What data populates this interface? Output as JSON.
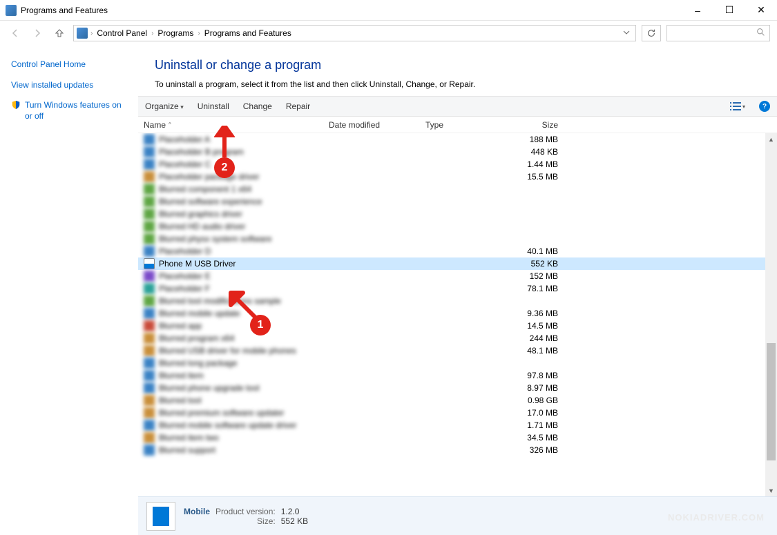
{
  "window": {
    "title": "Programs and Features",
    "minimize": "–",
    "maximize": "☐",
    "close": "✕"
  },
  "breadcrumb": {
    "items": [
      "Control Panel",
      "Programs",
      "Programs and Features"
    ],
    "sep": "›"
  },
  "sidebar": {
    "home": "Control Panel Home",
    "updates": "View installed updates",
    "features": "Turn Windows features on or off"
  },
  "page": {
    "heading": "Uninstall or change a program",
    "sub": "To uninstall a program, select it from the list and then click Uninstall, Change, or Repair."
  },
  "toolbar": {
    "organize": "Organize",
    "uninstall": "Uninstall",
    "change": "Change",
    "repair": "Repair",
    "help": "?"
  },
  "columns": {
    "name": "Name",
    "date": "Date modified",
    "type": "Type",
    "size": "Size"
  },
  "selected_row": {
    "name": "Phone M USB Driver",
    "size": "552 KB"
  },
  "rows": [
    {
      "name": "Placeholder A",
      "size": "188 MB",
      "ic": "ic1"
    },
    {
      "name": "Placeholder B program",
      "size": "448 KB",
      "ic": "ic1"
    },
    {
      "name": "Placeholder C",
      "size": "1.44 MB",
      "ic": "ic1"
    },
    {
      "name": "Placeholder package driver",
      "size": "15.5 MB",
      "ic": "ic3"
    },
    {
      "name": "Blurred component 1 x64",
      "size": "",
      "ic": "ic2"
    },
    {
      "name": "Blurred software experience",
      "size": "",
      "ic": "ic2"
    },
    {
      "name": "Blurred graphics driver",
      "size": "",
      "ic": "ic2"
    },
    {
      "name": "Blurred HD audio driver",
      "size": "",
      "ic": "ic2"
    },
    {
      "name": "Blurred physx system software",
      "size": "",
      "ic": "ic2"
    },
    {
      "name": "Placeholder D",
      "size": "40.1 MB",
      "ic": "ic1"
    },
    {
      "name": "Placeholder E",
      "size": "152 MB",
      "ic": "ic5"
    },
    {
      "name": "Placeholder F",
      "size": "78.1 MB",
      "ic": "ic6"
    },
    {
      "name": "Blurred tool modifications sample",
      "size": "",
      "ic": "ic2"
    },
    {
      "name": "Blurred mobile update",
      "size": "9.36 MB",
      "ic": "ic1"
    },
    {
      "name": "Blurred app",
      "size": "14.5 MB",
      "ic": "ic4"
    },
    {
      "name": "Blurred program x64",
      "size": "244 MB",
      "ic": "ic3"
    },
    {
      "name": "Blurred USB driver for mobile phones",
      "size": "48.1 MB",
      "ic": "ic3"
    },
    {
      "name": "Blurred long package",
      "size": "",
      "ic": "ic1"
    },
    {
      "name": "Blurred item",
      "size": "97.8 MB",
      "ic": "ic1"
    },
    {
      "name": "Blurred phone upgrade tool",
      "size": "8.97 MB",
      "ic": "ic1"
    },
    {
      "name": "Blurred tool",
      "size": "0.98 GB",
      "ic": "ic3"
    },
    {
      "name": "Blurred premium software updater",
      "size": "17.0 MB",
      "ic": "ic3"
    },
    {
      "name": "Blurred mobile software update driver",
      "size": "1.71 MB",
      "ic": "ic1"
    },
    {
      "name": "Blurred item two",
      "size": "34.5 MB",
      "ic": "ic3"
    },
    {
      "name": "Blurred support",
      "size": "326 MB",
      "ic": "ic1"
    }
  ],
  "status": {
    "name": "Mobile",
    "version_label": "Product version:",
    "version": "1.2.0",
    "size_label": "Size:",
    "size": "552 KB"
  },
  "annotations": {
    "one": "1",
    "two": "2"
  },
  "watermark": "NOKIADRIVER.COM"
}
